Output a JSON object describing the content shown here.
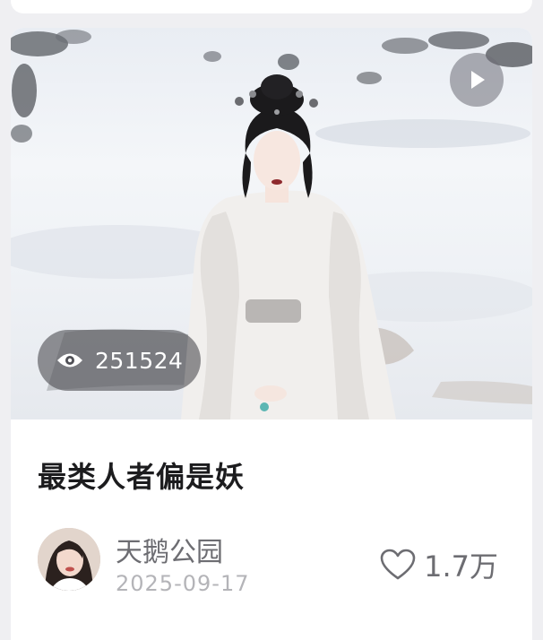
{
  "cover": {
    "views": "251524",
    "has_play_button": true
  },
  "post": {
    "title": "最类人者偏是妖",
    "author": "天鹅公园",
    "date": "2025-09-17",
    "likes": "1.7万"
  },
  "icons": {
    "play": "play-icon",
    "views": "eye-icon",
    "like": "heart-outline-icon"
  },
  "colors": {
    "title": "#1c1c1e",
    "meta": "#6d6d72",
    "date": "#b4b4b8",
    "overlay": "#505056"
  }
}
